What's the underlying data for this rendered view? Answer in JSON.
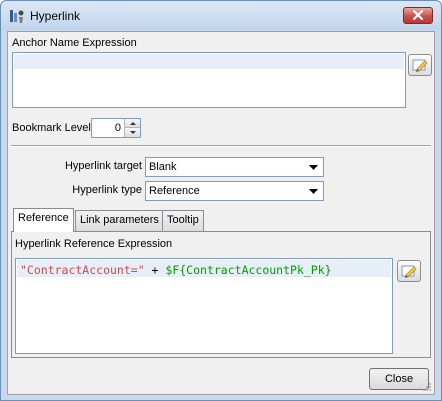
{
  "window": {
    "title": "Hyperlink"
  },
  "anchor": {
    "label": "Anchor Name Expression"
  },
  "bookmark": {
    "label": "Bookmark Level",
    "value": "0"
  },
  "hyperlink": {
    "target_label": "Hyperlink target",
    "target_value": "Blank",
    "type_label": "Hyperlink type",
    "type_value": "Reference"
  },
  "tabs": [
    {
      "label": "Reference",
      "active": true
    },
    {
      "label": "Link parameters",
      "active": false
    },
    {
      "label": "Tooltip",
      "active": false
    }
  ],
  "reference": {
    "label": "Hyperlink Reference Expression",
    "expr_string": "\"ContractAccount=\"",
    "expr_operator": " + ",
    "expr_field": "$F{ContractAccountPk_Pk}"
  },
  "footer": {
    "close_label": "Close"
  },
  "icons": {
    "app": "hyperlink-app-icon",
    "close": "close-icon",
    "edit": "expression-editor-icon",
    "spin_up": "arrow-up-icon",
    "spin_down": "arrow-down-icon",
    "dropdown": "chevron-down-icon",
    "grip": "resize-grip-icon"
  }
}
